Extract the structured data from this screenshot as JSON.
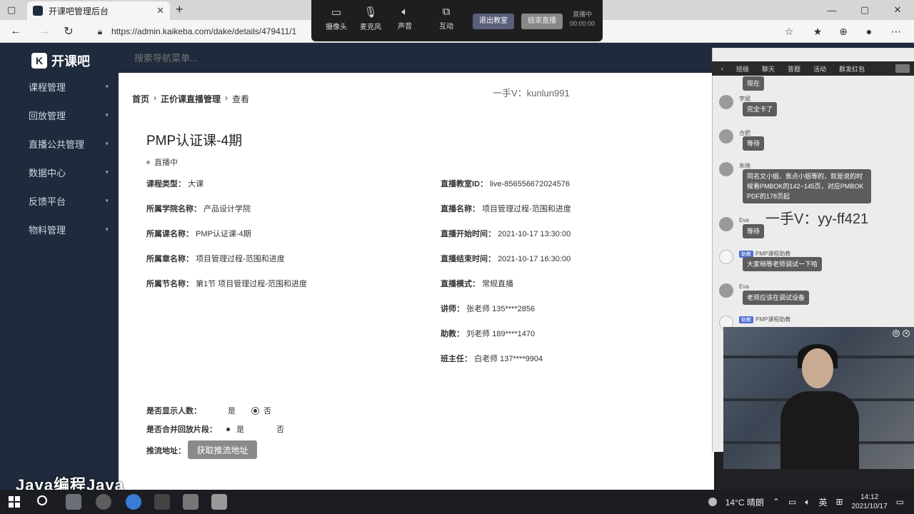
{
  "browser": {
    "tab_title": "开课吧管理后台",
    "url": "https://admin.kaikeba.com/dake/details/479411/1"
  },
  "meeting": {
    "camera": "摄像头",
    "mic": "麦克风",
    "sound": "声音",
    "interact": "互动",
    "exit": "退出教室",
    "record": "结束直播",
    "live_label": "直播中",
    "live_time": "00:00:00"
  },
  "sidebar": {
    "logo": "开课吧",
    "items": [
      {
        "label": "课程管理"
      },
      {
        "label": "回放管理"
      },
      {
        "label": "直播公共管理"
      },
      {
        "label": "数据中心"
      },
      {
        "label": "反馈平台"
      },
      {
        "label": "物料管理"
      }
    ]
  },
  "search": {
    "placeholder": "搜索导航菜单..."
  },
  "breadcrumb": [
    "首页",
    "正价课直播管理",
    "查看"
  ],
  "watermarks": {
    "top": "一手V：kunlun991",
    "chat": "一手V：yy-ff421",
    "bottom": "Java编程Java"
  },
  "course": {
    "title": "PMP认证课-4期",
    "status": "直播中",
    "left": [
      {
        "k": "课程类型：",
        "v": "大课"
      },
      {
        "k": "所属学院名称：",
        "v": "产品设计学院"
      },
      {
        "k": "所属课名称：",
        "v": "PMP认证课-4期"
      },
      {
        "k": "所属章名称：",
        "v": "项目管理过程-范围和进度"
      },
      {
        "k": "所属节名称：",
        "v": "第1节 项目管理过程-范围和进度"
      }
    ],
    "right": [
      {
        "k": "直播教室ID：",
        "v": "live-856556672024576"
      },
      {
        "k": "直播名称：",
        "v": "项目管理过程-范围和进度"
      },
      {
        "k": "直播开始时间：",
        "v": "2021-10-17 13:30:00"
      },
      {
        "k": "直播结束时间：",
        "v": "2021-10-17 16:30:00"
      },
      {
        "k": "直播模式：",
        "v": "常规直播"
      },
      {
        "k": "讲师：",
        "v": "张老师 135****2856"
      },
      {
        "k": "助教：",
        "v": "刘老师 189****1470"
      },
      {
        "k": "班主任：",
        "v": "白老师 137****9904"
      }
    ],
    "show_count": {
      "k": "是否显示人数：",
      "yes": "是",
      "no": "否"
    },
    "merge_replay": {
      "k": "是否合并回放片段：",
      "yes": "是",
      "no": "否"
    },
    "push_url": {
      "k": "推流地址：",
      "button": "获取推流地址"
    }
  },
  "chat": {
    "tabs": [
      "班级",
      "聊天",
      "答题",
      "活动",
      "群发红包"
    ],
    "messages": [
      {
        "name": "",
        "text": "现在"
      },
      {
        "name": "李斌",
        "text": "完全卡了"
      },
      {
        "name": "合肥",
        "text": "等待"
      },
      {
        "name": "朱晓",
        "text": "同名文小姐、焦点小姐等的，就是说的时候看PMBOK的142~145页，对应PMBOK PDF的178页起"
      },
      {
        "name": "Eva",
        "text": "等待"
      },
      {
        "tag": "助教",
        "name": "PMP课程助教",
        "text": "大家稍等老师调试一下哈"
      },
      {
        "name": "Eva",
        "text": "老师应该在调试设备"
      },
      {
        "tag": "助教",
        "name": "PMP课程助教",
        "text": ""
      }
    ]
  },
  "tray": {
    "weather": "14°C 晴朗",
    "ime": "英",
    "time": "14:12",
    "date": "2021/10/17"
  }
}
